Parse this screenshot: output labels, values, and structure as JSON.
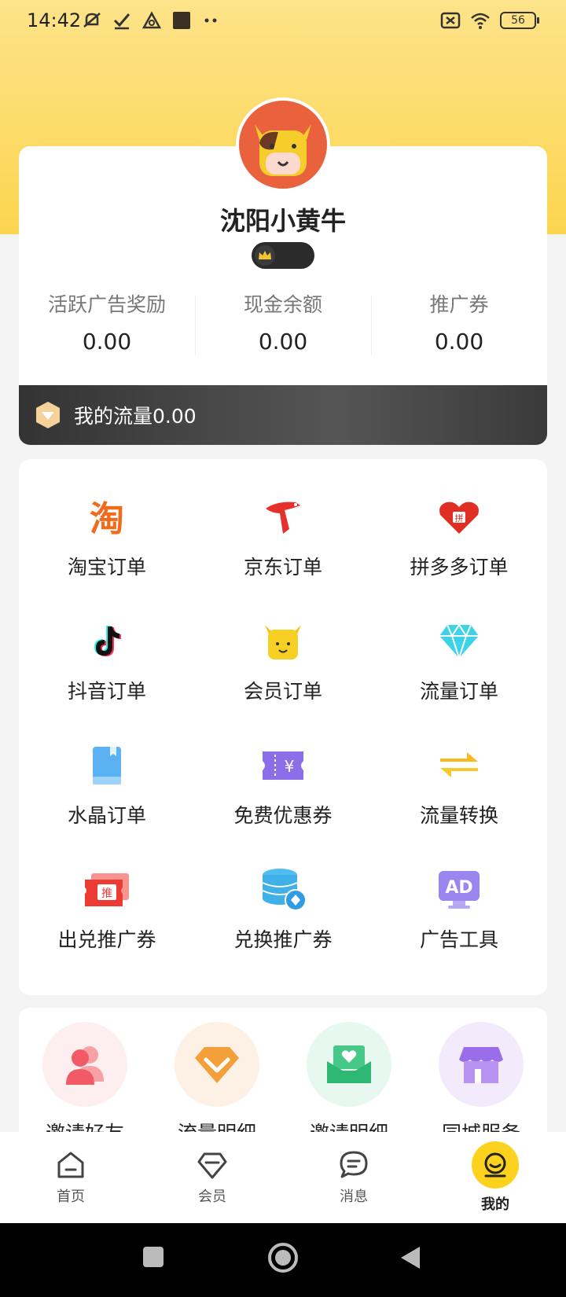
{
  "status_bar": {
    "time": "14:42",
    "battery": "56"
  },
  "profile": {
    "username": "沈阳小黄牛",
    "stats": [
      {
        "label": "活跃广告奖励",
        "value": "0.00"
      },
      {
        "label": "现金余额",
        "value": "0.00"
      },
      {
        "label": "推广券",
        "value": "0.00"
      }
    ],
    "traffic_text": "我的流量0.00"
  },
  "grid": [
    {
      "label": "淘宝订单",
      "icon": "taobao-icon"
    },
    {
      "label": "京东订单",
      "icon": "jd-icon"
    },
    {
      "label": "拼多多订单",
      "icon": "pinduoduo-icon"
    },
    {
      "label": "抖音订单",
      "icon": "douyin-icon"
    },
    {
      "label": "会员订单",
      "icon": "member-cow-icon"
    },
    {
      "label": "流量订单",
      "icon": "diamond-icon"
    },
    {
      "label": "水晶订单",
      "icon": "book-icon"
    },
    {
      "label": "免费优惠券",
      "icon": "coupon-icon"
    },
    {
      "label": "流量转换",
      "icon": "exchange-arrows-icon"
    },
    {
      "label": "出兑推广券",
      "icon": "promo-ticket-icon"
    },
    {
      "label": "兑换推广券",
      "icon": "coins-stack-icon"
    },
    {
      "label": "广告工具",
      "icon": "ad-monitor-icon"
    }
  ],
  "quick": [
    {
      "label": "邀请好友",
      "icon": "invite-friends-icon"
    },
    {
      "label": "流量明细",
      "icon": "traffic-detail-icon"
    },
    {
      "label": "邀请明细",
      "icon": "invite-detail-icon"
    },
    {
      "label": "同城服务",
      "icon": "local-service-icon"
    }
  ],
  "tabs": [
    {
      "label": "首页",
      "icon": "home-icon"
    },
    {
      "label": "会员",
      "icon": "member-icon"
    },
    {
      "label": "消息",
      "icon": "message-icon"
    },
    {
      "label": "我的",
      "icon": "profile-icon"
    }
  ],
  "colors": {
    "accent": "#fcd21e",
    "header_bg": "#fcd54f",
    "avatar_bg": "#e9613d"
  }
}
